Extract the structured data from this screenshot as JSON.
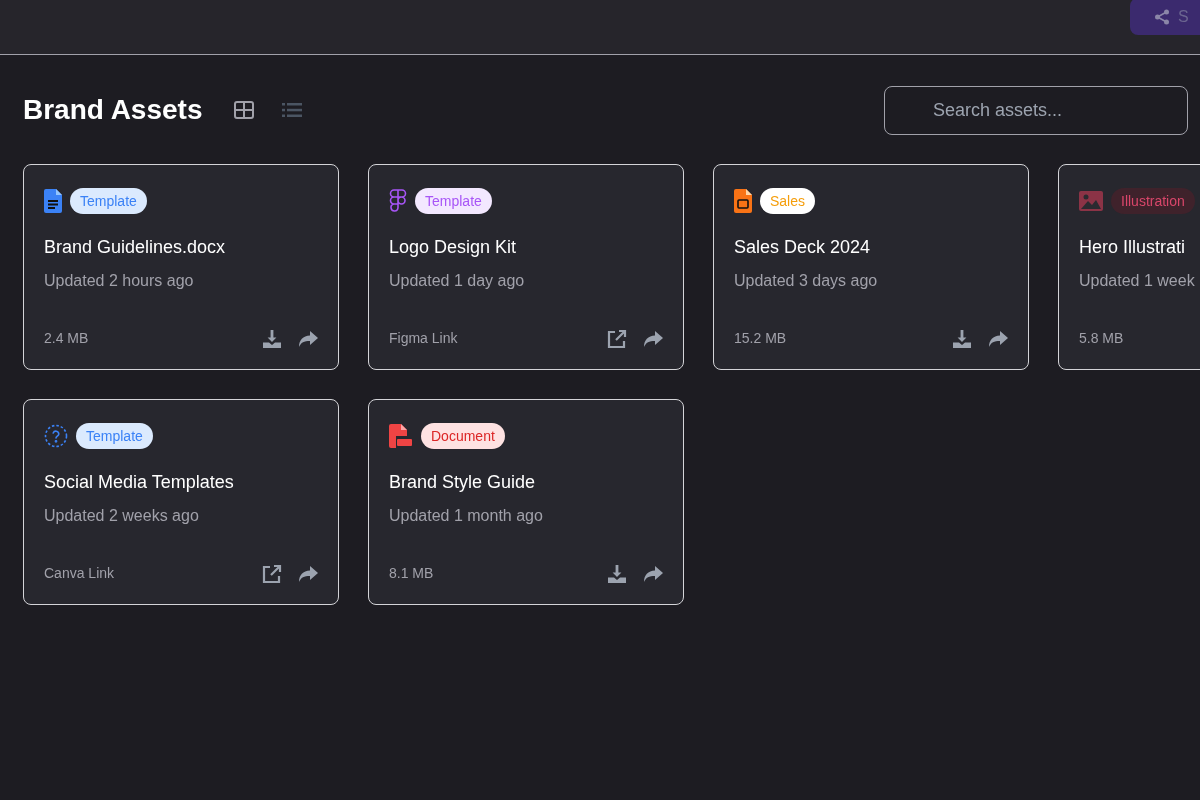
{
  "top_bar": {
    "share_button": {
      "label": "S"
    }
  },
  "header": {
    "title": "Brand Assets",
    "views": [
      {
        "kind": "grid",
        "selected": true
      },
      {
        "kind": "list",
        "selected": false
      }
    ],
    "search": {
      "placeholder": "Search assets..."
    }
  },
  "assets": [
    {
      "kind": "word",
      "tag": {
        "label": "Template",
        "color": "#3b82f6"
      },
      "title": "Brand Guidelines.docx",
      "updated": "Updated 2 hours ago",
      "meta": "2.4 MB",
      "actions": [
        {
          "kind": "download"
        },
        {
          "kind": "share"
        }
      ]
    },
    {
      "kind": "figma",
      "tag": {
        "label": "Template",
        "color": "#a855f7"
      },
      "title": "Logo Design Kit",
      "updated": "Updated 1 day ago",
      "meta": "Figma Link",
      "actions": [
        {
          "kind": "open"
        },
        {
          "kind": "share"
        }
      ]
    },
    {
      "kind": "slides",
      "tag": {
        "label": "Sales",
        "color": "#f59e0b"
      },
      "title": "Sales Deck 2024",
      "updated": "Updated 3 days ago",
      "meta": "15.2 MB",
      "actions": [
        {
          "kind": "download"
        },
        {
          "kind": "share"
        }
      ]
    },
    {
      "kind": "image",
      "tag": {
        "label": "Illustration",
        "color": "#d9466a"
      },
      "title": "Hero Illustrati",
      "updated": "Updated 1 week",
      "meta": "5.8 MB"
    },
    {
      "kind": "unknown",
      "tag": {
        "label": "Template",
        "color": "#3b82f6"
      },
      "title": "Social Media Templates",
      "updated": "Updated 2 weeks ago",
      "meta": "Canva Link",
      "actions": [
        {
          "kind": "open"
        },
        {
          "kind": "share"
        }
      ]
    },
    {
      "kind": "pdf",
      "tag": {
        "label": "Document",
        "color": "#dc2626"
      },
      "title": "Brand Style Guide",
      "updated": "Updated 1 month ago",
      "meta": "8.1 MB",
      "actions": [
        {
          "kind": "download"
        },
        {
          "kind": "share"
        }
      ]
    }
  ]
}
